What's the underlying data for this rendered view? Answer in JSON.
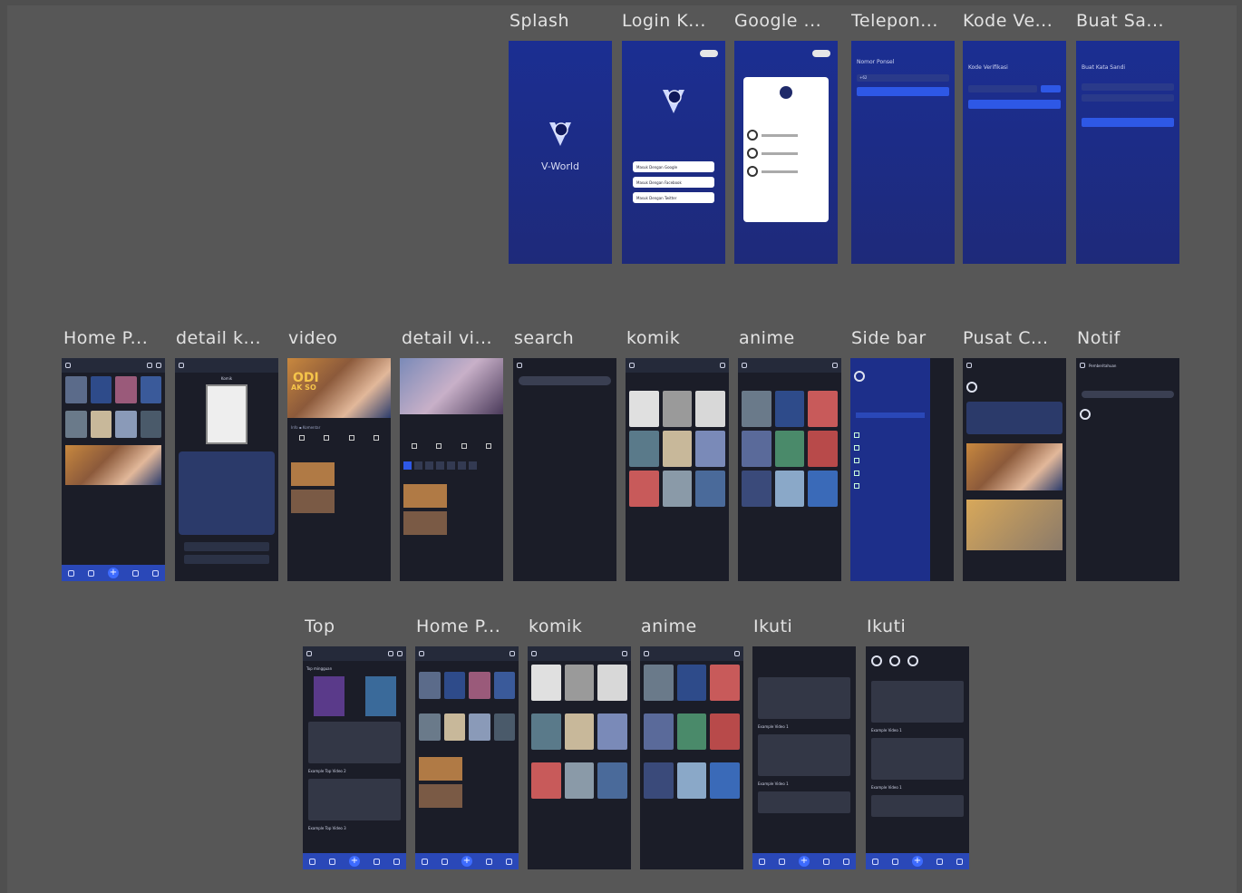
{
  "frames": {
    "row1": [
      {
        "label": "Splash"
      },
      {
        "label": "Login K..."
      },
      {
        "label": "Google ..."
      },
      {
        "label": "Telepon..."
      },
      {
        "label": "Kode Ve..."
      },
      {
        "label": "Buat Sa..."
      }
    ],
    "row2": [
      {
        "label": "Home P..."
      },
      {
        "label": "detail k..."
      },
      {
        "label": "video"
      },
      {
        "label": "detail vi..."
      },
      {
        "label": "search"
      },
      {
        "label": "komik"
      },
      {
        "label": "anime"
      },
      {
        "label": "Side bar"
      },
      {
        "label": "Pusat C..."
      },
      {
        "label": "Notif"
      }
    ],
    "row3": [
      {
        "label": "Top"
      },
      {
        "label": "Home P..."
      },
      {
        "label": "komik"
      },
      {
        "label": "anime"
      },
      {
        "label": "Ikuti"
      },
      {
        "label": "Ikuti"
      }
    ]
  },
  "splash": {
    "brand": "V-World"
  },
  "login": {
    "google": "Masuk Dengan Google",
    "facebook": "Masuk Dengan Facebook",
    "twitter": "Masuk Dengan Twitter"
  },
  "phone": {
    "title": "Nomor Ponsel",
    "code": "+62",
    "button": "Lanjut"
  },
  "verify": {
    "title": "Kode Verifikasi",
    "button": "Lanjut"
  },
  "password": {
    "title": "Buat Kata Sandi",
    "button": "Buat Sandi"
  },
  "video": {
    "badge": "ODI",
    "sub": "AK SO"
  },
  "detail_komik": {
    "title": "Komik"
  },
  "notif": {
    "title": "Pemberitahuan"
  },
  "top": {
    "section": "Top mingguan",
    "item2": "Example Top Video 2",
    "item3": "Example Top Video 3"
  },
  "ikuti": {
    "item": "Example Video 1"
  },
  "colors": {
    "canvas": "#575757",
    "screen_dark": "#1b1d28",
    "screen_blue": "#1e2a7a",
    "accent": "#2e58e6"
  }
}
